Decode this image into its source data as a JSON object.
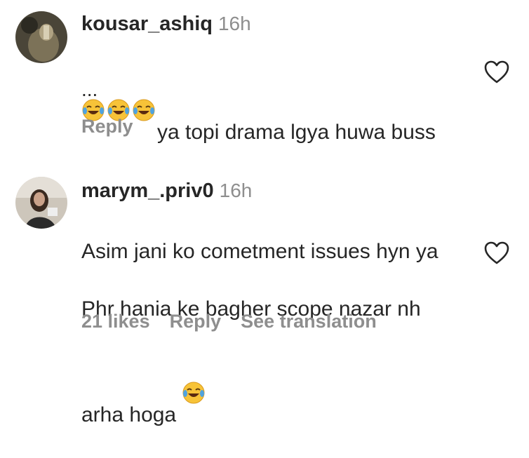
{
  "comments": [
    {
      "username": "kousar_ashiq",
      "time": "16h",
      "text": "ya topi drama lgya huwa buss",
      "emojis": [
        "tears-of-joy",
        "tears-of-joy",
        "tears-of-joy"
      ],
      "truncated": "...",
      "reply_label": "Reply"
    },
    {
      "username": "marym_.priv0",
      "time": "16h",
      "text_lines": [
        "Asim jani ko cometment issues hyn ya",
        "Phr hania ke bagher scope nazar nh",
        "arha hoga"
      ],
      "emoji_trailing": "tears-of-joy",
      "likes_label": "21 likes",
      "reply_label": "Reply",
      "translation_label": "See translation"
    }
  ],
  "icons": {
    "like": "heart-outline-icon",
    "emoji": "tears-of-joy-emoji"
  },
  "colors": {
    "text": "#262626",
    "muted": "#8e8e8e",
    "emoji_face": "#f7c338",
    "emoji_tear": "#4fa3e0"
  }
}
